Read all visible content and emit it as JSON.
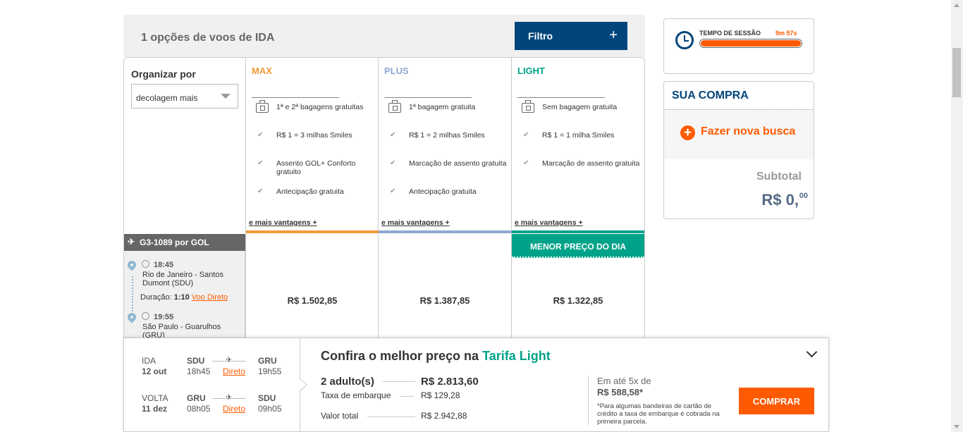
{
  "results": {
    "title": "1 opções de voos de IDA",
    "filter_label": "Filtro",
    "filter_plus": "+"
  },
  "sort": {
    "label": "Organizar por",
    "value": "decolagem mais"
  },
  "fares": [
    {
      "name": "MAX",
      "color": "#f29a38",
      "benefits": [
        "1ª e 2ª bagagens gratuitas",
        "R$ 1 = 3 milhas Smiles",
        "Assento GOL+ Conforto gratuito",
        "Antecipação gratuita"
      ],
      "more": "e mais vantagens +",
      "price": "R$ 1.502,85"
    },
    {
      "name": "PLUS",
      "color": "#8fa9cf",
      "benefits": [
        "1ª bagagem gratuita",
        "R$ 1 = 2 milhas Smiles",
        "Marcação de assento gratuita",
        "Antecipação gratuita"
      ],
      "more": "e mais vantagens +",
      "price": "R$ 1.387,85"
    },
    {
      "name": "LIGHT",
      "color": "#00a389",
      "benefits": [
        "Sem bagagem gratuita",
        "R$ 1 = 1 milha Smiles",
        "Marcação de assento gratuita"
      ],
      "more": "e mais vantagens +",
      "price": "R$ 1.322,85",
      "badge": "MENOR  PREÇO DO DIA"
    }
  ],
  "flight": {
    "code": "G3-1089 por  GOL",
    "dep_time": "18:45",
    "dep_place": "Rio de Janeiro - Santos Dumont (SDU)",
    "duration_label": "Duração:",
    "duration": "1:10",
    "direct": "Voo Direto",
    "arr_time": "19:55",
    "arr_place": "São Paulo - Guarulhos (GRU)"
  },
  "session": {
    "label": "TEMPO DE SESSÃO",
    "time": "9m 57s",
    "remaining_fraction": 1.0
  },
  "purchase": {
    "title": "SUA COMPRA",
    "new_search": "Fazer nova busca",
    "subtotal_label": "Subtotal",
    "subtotal_value": "R$ 0,",
    "subtotal_cents": "00"
  },
  "summary": {
    "legs": [
      {
        "type": "IDA",
        "date": "12 out",
        "from": "SDU",
        "dep": "18h45",
        "direct": "Direto",
        "to": "GRU",
        "arr": "19h55"
      },
      {
        "type": "VOLTA",
        "date": "11 dez",
        "from": "GRU",
        "dep": "08h05",
        "direct": "Direto",
        "to": "SDU",
        "arr": "09h05"
      }
    ],
    "title_prefix": "Confira o melhor preço na",
    "title_accent": "Tarifa Light",
    "adults_label": "2 adulto(s)",
    "adults_value": "R$ 2.813,60",
    "tax_label": "Taxa de embarque",
    "tax_value": "R$ 129,28",
    "total_label": "Valor total",
    "total_value": "R$ 2.942,88",
    "installments_label": "Em até 5x de",
    "installments_value": "R$ 588,58*",
    "installments_note": "*Para algumas bandeiras de cartão de crédito a taxa de embarque é cobrada na primeira parcela.",
    "buy_label": "COMPRAR"
  }
}
